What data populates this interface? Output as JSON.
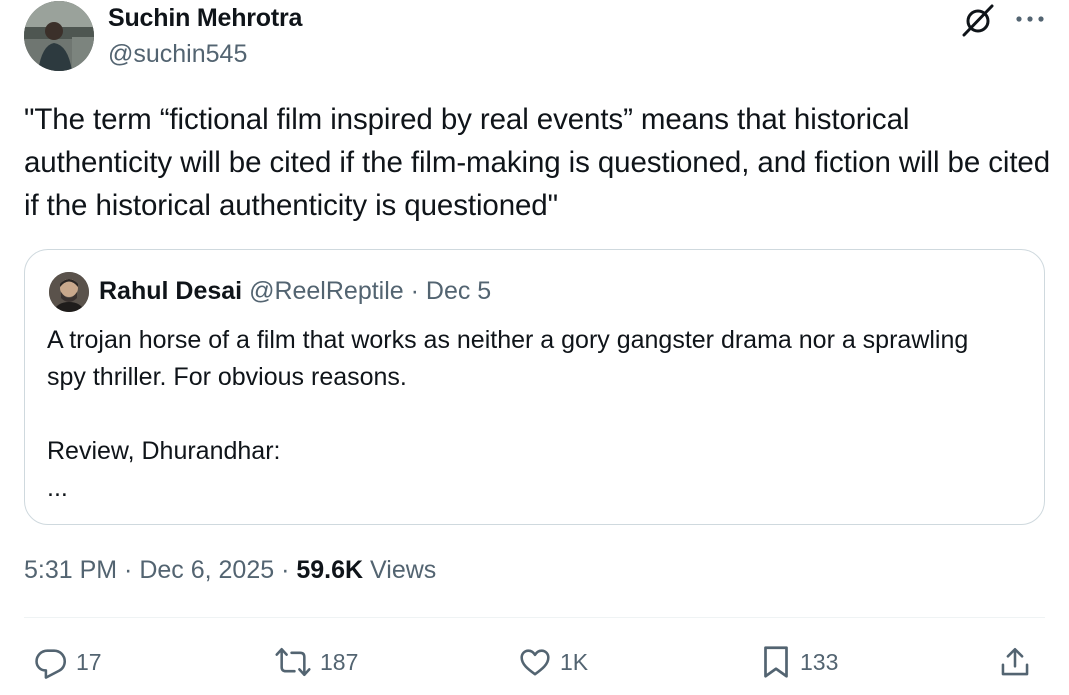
{
  "author": {
    "name": "Suchin Mehrotra",
    "handle": "@suchin545"
  },
  "tweet_text": "\"The term “fictional film inspired by real events” means that historical authenticity will be cited if the film-making is questioned, and fiction will be cited if the historical authenticity is questioned\"",
  "quote": {
    "name": "Rahul Desai",
    "handle": "@ReelReptile",
    "separator": " · ",
    "date": "Dec 5",
    "lines": [
      "A trojan horse of a film that works as neither a gory gangster drama nor a sprawling spy thriller. For obvious reasons.",
      "",
      "Review, Dhurandhar:",
      "..."
    ]
  },
  "meta": {
    "time": "5:31 PM",
    "separator": " · ",
    "date": "Dec 6, 2025",
    "views_count": "59.6K",
    "views_label": " Views"
  },
  "actions": {
    "replies": "17",
    "reposts": "187",
    "likes": "1K",
    "bookmarks": "133"
  },
  "icons": {
    "header": [
      "grok-icon",
      "more-icon"
    ],
    "actions": [
      "reply-icon",
      "repost-icon",
      "like-icon",
      "bookmark-icon",
      "share-icon"
    ]
  },
  "colors": {
    "text_primary": "#0f1419",
    "text_secondary": "#536471",
    "border": "#cfd9de",
    "divider": "#eff3f4"
  }
}
